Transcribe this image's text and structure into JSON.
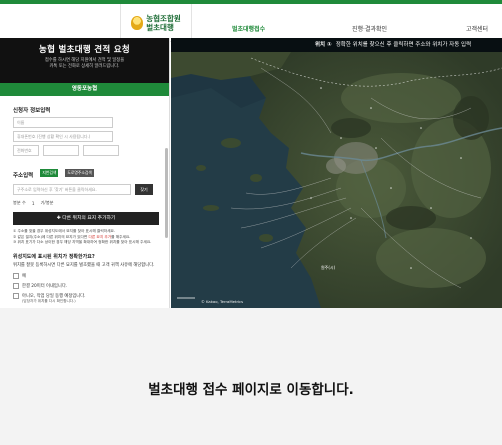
{
  "nav": {
    "logo_line1": "농협조합원",
    "logo_line2": "벌초대행",
    "items": [
      "벌초대행접수",
      "진행·결과확인",
      "고객센터"
    ]
  },
  "panel": {
    "title": "농협 벌초대행 견적 요청",
    "desc_line1": "접수를 하시면 해당 지원에서 견적 및 일정을",
    "desc_line2": "카톡 또는 전화로 상세히 알려드립니다.",
    "branch": "영동포농협"
  },
  "applicant": {
    "section": "신청자 정보입력",
    "name_placeholder": "이름",
    "phone_placeholder": "휴대폰번호 (진행 상황 확인 시 사용됩니다.)",
    "email_placeholder": "전화번호"
  },
  "address": {
    "section": "주소입력",
    "tag1": "지번검색",
    "tag2": "도로명주소검색",
    "input_placeholder": "구주소로 입력하신 후 '찾기' 버튼을 클릭하세요.",
    "search_btn": "찾기",
    "count_label": "봉분 수",
    "count_value": "1",
    "unit_label": "기/봉분",
    "add_btn": "✚ 다른 위치의 묘지 추가하기"
  },
  "notes": [
    "주소를 찾을 경우 위성지도에서 묘지를 찾아 표시해 클릭하세요.",
    "같은 필지(주소)에 다른 위치의 묘지가 있다면 다른 묘지 추가를 해주세요.",
    "위치 표기가 다소 상이한 경우 해당 지역을 확대하여 정확한 위치를 찾아 표시해 주세요."
  ],
  "notes_highlight": "다른 묘지 추가",
  "question": {
    "title": "위성지도에 표시된 위치가 정확한가요?",
    "desc": "위치를 잘못 등록하시면 다른 묘지를 벌초했을 때 고객 귀책 사유에 해당합니다.",
    "options": [
      "예",
      "한결 20미터 이내입니다.",
      "아니오, 작업 당일 동행 예정입니다."
    ],
    "option_note": "(담당자가 위치를 다시 확인합니다.)"
  },
  "map": {
    "instruction_prefix": "위치 ①",
    "instruction": "정확한 위치를 찾으신 후 클릭하면 주소와 위치가 자동 입력",
    "label_bottom": "원주(시)",
    "attribution": "© Kakao, TerraMetrics"
  },
  "modal": {
    "message": "벌초대행 접수 페이지로 이동합니다."
  },
  "colors": {
    "brand_green": "#1f8a3a",
    "header_dark": "#111111",
    "alert_red": "#d0302a"
  }
}
